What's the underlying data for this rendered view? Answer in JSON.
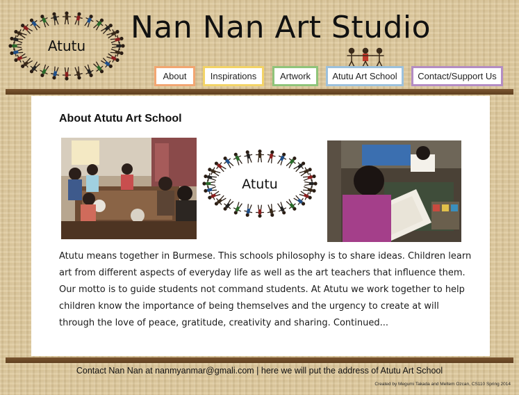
{
  "site": {
    "title": "Nan Nan Art Studio",
    "logo_text": "Atutu"
  },
  "nav": {
    "items": [
      {
        "label": "About",
        "color": "#f2a672"
      },
      {
        "label": "Inspirations",
        "color": "#f3d467"
      },
      {
        "label": "Artwork",
        "color": "#8fc47a"
      },
      {
        "label": "Atutu Art School",
        "color": "#9cc1dd"
      },
      {
        "label": "Contact/Support Us",
        "color": "#b48dc4"
      }
    ]
  },
  "main": {
    "title": "About Atutu Art School",
    "logo_text": "Atutu",
    "body": "Atutu means together in Burmese. This schools philosophy is to share ideas. Children learn art from different aspects of everyday life as well as the art teachers that influence them. Our motto is to guide students not command students. At Atutu we work together to help children know the importance of being themselves and the urgency to create at will through the love of peace, gratitude, creativity and sharing.  Continued..."
  },
  "footer": {
    "contact": "Contact Nan Nan at nanmyanmar@gmali.com | here we will put the address of Atutu Art School",
    "credit": "Created by Megumi Takada and Meltem Ozcan, CS110 Spring 2014"
  },
  "colors": {
    "background": "#ddc79a",
    "bar": "#6b4a28"
  },
  "icons": [
    "people-ring-logo",
    "children-figures-icon",
    "classroom-photo",
    "child-painting-photo"
  ]
}
